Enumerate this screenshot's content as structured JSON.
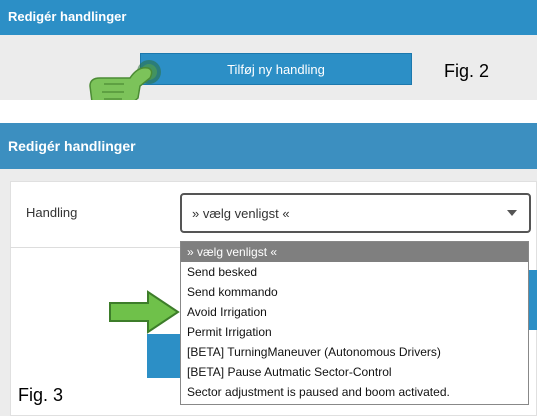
{
  "fig2": {
    "header_title": "Redigér handlinger",
    "add_button_label": "Tilføj ny handling",
    "caption": "Fig. 2"
  },
  "fig3": {
    "header_title": "Redigér handlinger",
    "field_label": "Handling",
    "select_value": "» vælg venligst «",
    "caption": "Fig. 3",
    "options": [
      "» vælg venligst «",
      "Send besked",
      "Send kommando",
      "Avoid Irrigation",
      "Permit Irrigation",
      "[BETA] TurningManeuver (Autonomous Drivers)",
      "[BETA] Pause Autmatic Sector-Control",
      "Sector adjustment is paused and boom activated."
    ]
  },
  "colors": {
    "accent": "#2c8fc6",
    "pointer_green": "#6fc14a"
  },
  "icons": [
    "hand-pointer-icon",
    "arrow-right-icon",
    "chevron-down-icon"
  ]
}
